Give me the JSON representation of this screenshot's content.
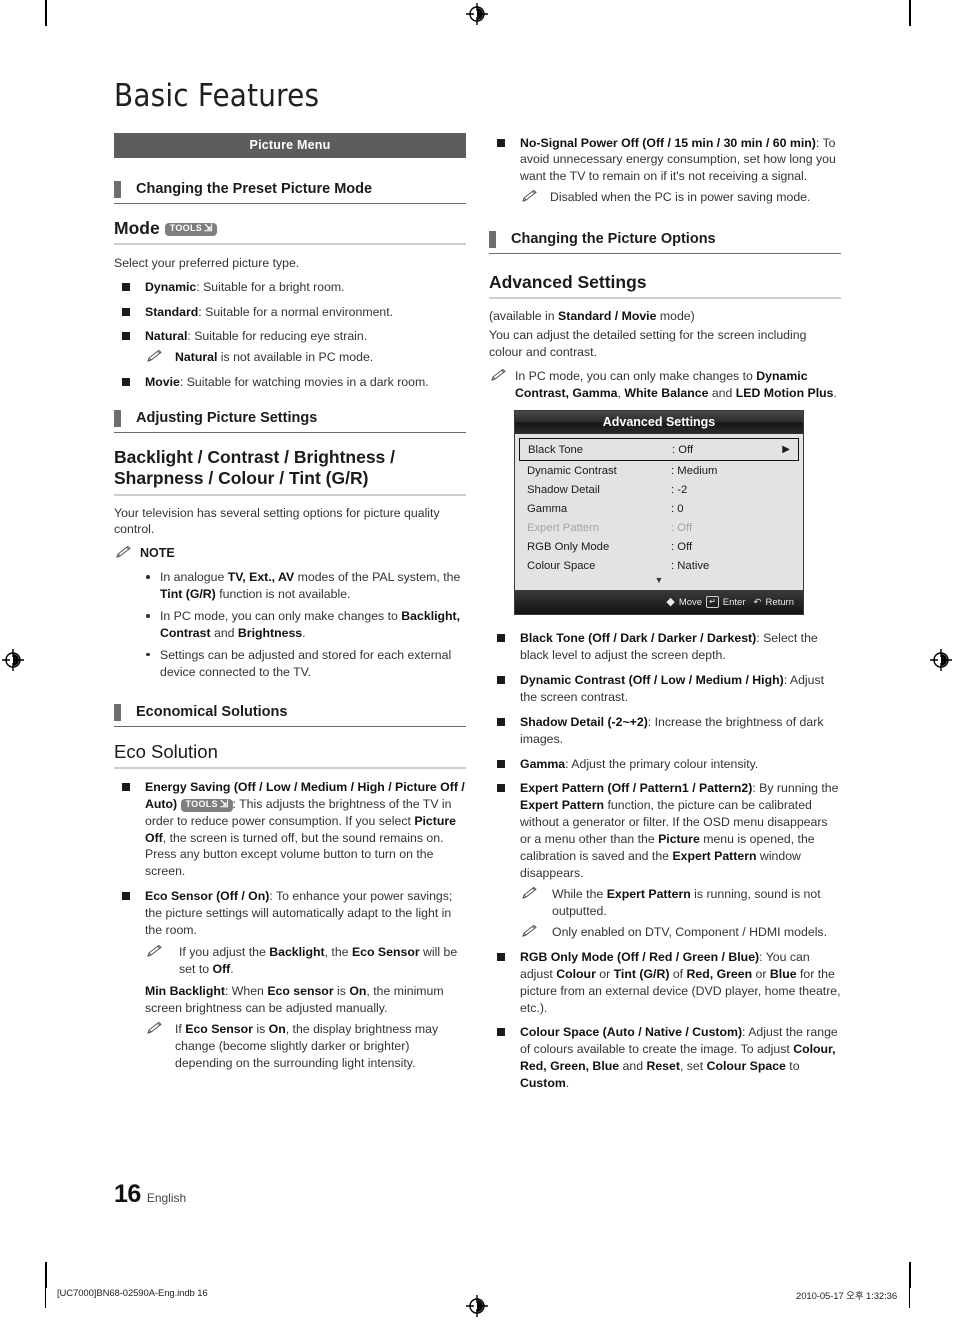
{
  "document": {
    "title": "Basic Features",
    "page_number": "16",
    "language": "English"
  },
  "print_footer": {
    "file": "[UC7000]BN68-02590A-Eng.indb   16",
    "timestamp": "2010-05-17   오후 1:32:36"
  },
  "left_column": {
    "banner": "Picture Menu",
    "section_1": {
      "heading": "Changing the Preset Picture Mode",
      "title": "Mode",
      "tools_badge": "TOOLS",
      "intro": "Select your preferred picture type.",
      "items": [
        {
          "term": "Dynamic",
          "desc": ": Suitable for a bright room."
        },
        {
          "term": "Standard",
          "desc": ": Suitable for a normal environment."
        },
        {
          "term": "Natural",
          "desc": ": Suitable for reducing eye strain."
        },
        {
          "term": "Movie",
          "desc": ": Suitable for watching movies in a dark room."
        }
      ],
      "natural_note_bold": "Natural",
      "natural_note_rest": " is not available in PC mode."
    },
    "section_2": {
      "heading": "Adjusting Picture Settings",
      "title": "Backlight / Contrast / Brightness / Sharpness / Colour / Tint (G/R)",
      "intro": "Your television has several setting options for picture quality control.",
      "note_label": "NOTE",
      "notes": [
        "In analogue TV, Ext., AV modes of the PAL system, the Tint (G/R) function is not available.",
        "In PC mode, you can only make changes to Backlight, Contrast and Brightness.",
        "Settings can be adjusted and stored for each external device connected to the TV."
      ]
    },
    "section_3": {
      "heading": "Economical Solutions",
      "title": "Eco Solution",
      "energy_saving_term": "Energy Saving (Off / Low / Medium / High / Picture Off / Auto)",
      "energy_saving_tools": "TOOLS",
      "energy_saving_desc": ": This adjusts the brightness of the TV in order to reduce power consumption. If you select Picture Off, the screen is turned off, but the sound remains on. Press any button except volume button to turn on the screen.",
      "eco_sensor_term": "Eco Sensor (Off / On)",
      "eco_sensor_desc": ": To enhance your power savings; the picture settings will automatically adapt to the light in the room.",
      "eco_sensor_note": "If you adjust the Backlight, the Eco Sensor will be set to Off.",
      "min_backlight_term": "Min Backlight",
      "min_backlight_desc": ": When Eco sensor is On, the minimum screen brightness can be adjusted manually.",
      "min_backlight_note": "If Eco Sensor is On, the display brightness may change (become slightly darker or brighter) depending on the surrounding light intensity."
    }
  },
  "right_column": {
    "no_signal_term": "No-Signal Power Off (Off / 15 min / 30 min / 60 min)",
    "no_signal_desc": ": To avoid unnecessary energy consumption, set how long you want the TV to remain on if it's not receiving a signal.",
    "no_signal_note": "Disabled when the PC is in power saving mode.",
    "section_heading": "Changing the Picture Options",
    "title": "Advanced Settings",
    "available_in_pre": "(available in ",
    "available_in_bold": "Standard / Movie",
    "available_in_post": " mode)",
    "intro": "You can adjust the detailed setting for the screen including colour and contrast.",
    "pc_note_pre": "In PC mode, you can only make changes to ",
    "pc_note_bold1": "Dynamic Contrast, Gamma",
    "pc_note_mid": ", ",
    "pc_note_bold2": "White Balance",
    "pc_note_and": " and ",
    "pc_note_bold3": "LED Motion Plus",
    "pc_note_end": ".",
    "items": [
      {
        "term": "Black Tone (Off / Dark / Darker / Darkest)",
        "desc": ": Select the black level to adjust the screen depth."
      },
      {
        "term": "Dynamic Contrast (Off / Low / Medium / High)",
        "desc": ": Adjust the screen contrast."
      },
      {
        "term": "Shadow Detail (-2~+2)",
        "desc": ": Increase the brightness of dark images."
      },
      {
        "term": "Gamma",
        "desc": ": Adjust the primary colour intensity."
      }
    ],
    "expert_pattern_term": "Expert Pattern (Off / Pattern1 / Pattern2)",
    "expert_pattern_desc": ": By running the Expert Pattern function, the picture can be calibrated without a generator or filter. If the OSD menu disappears or a menu other than the Picture menu is opened, the calibration is saved and the Expert Pattern window disappears.",
    "expert_note_1": "While the Expert Pattern is running, sound is not outputted.",
    "expert_note_2": "Only enabled on DTV, Component / HDMI models.",
    "rgb_term": "RGB Only Mode (Off / Red / Green / Blue)",
    "rgb_desc": ": You can adjust Colour or Tint (G/R) of Red, Green or Blue for the picture from an external device (DVD player, home theatre, etc.).",
    "colour_space_term": "Colour Space (Auto / Native / Custom)",
    "colour_space_desc": ": Adjust the range of colours available to create the image. To adjust Colour, Red, Green, Blue and Reset, set Colour Space to Custom."
  },
  "osd": {
    "title": "Advanced Settings",
    "rows": [
      {
        "label": "Black Tone",
        "value": ": Off",
        "selected": true,
        "dim": false,
        "arrow": "▶"
      },
      {
        "label": "Dynamic Contrast",
        "value": ": Medium",
        "selected": false,
        "dim": false,
        "arrow": ""
      },
      {
        "label": "Shadow Detail",
        "value": ": -2",
        "selected": false,
        "dim": false,
        "arrow": ""
      },
      {
        "label": "Gamma",
        "value": ": 0",
        "selected": false,
        "dim": false,
        "arrow": ""
      },
      {
        "label": "Expert Pattern",
        "value": ": Off",
        "selected": false,
        "dim": true,
        "arrow": ""
      },
      {
        "label": "RGB Only Mode",
        "value": ": Off",
        "selected": false,
        "dim": false,
        "arrow": ""
      },
      {
        "label": "Colour Space",
        "value": ": Native",
        "selected": false,
        "dim": false,
        "arrow": ""
      }
    ],
    "scroll_down": "▼",
    "footer": {
      "move": "Move",
      "enter": "Enter",
      "return": "Return"
    }
  },
  "colors": {
    "banner_bg": "#5d5d5d",
    "rule": "#cfcfcf",
    "osd_body": "#e3e3e3",
    "text": "#231f20"
  }
}
